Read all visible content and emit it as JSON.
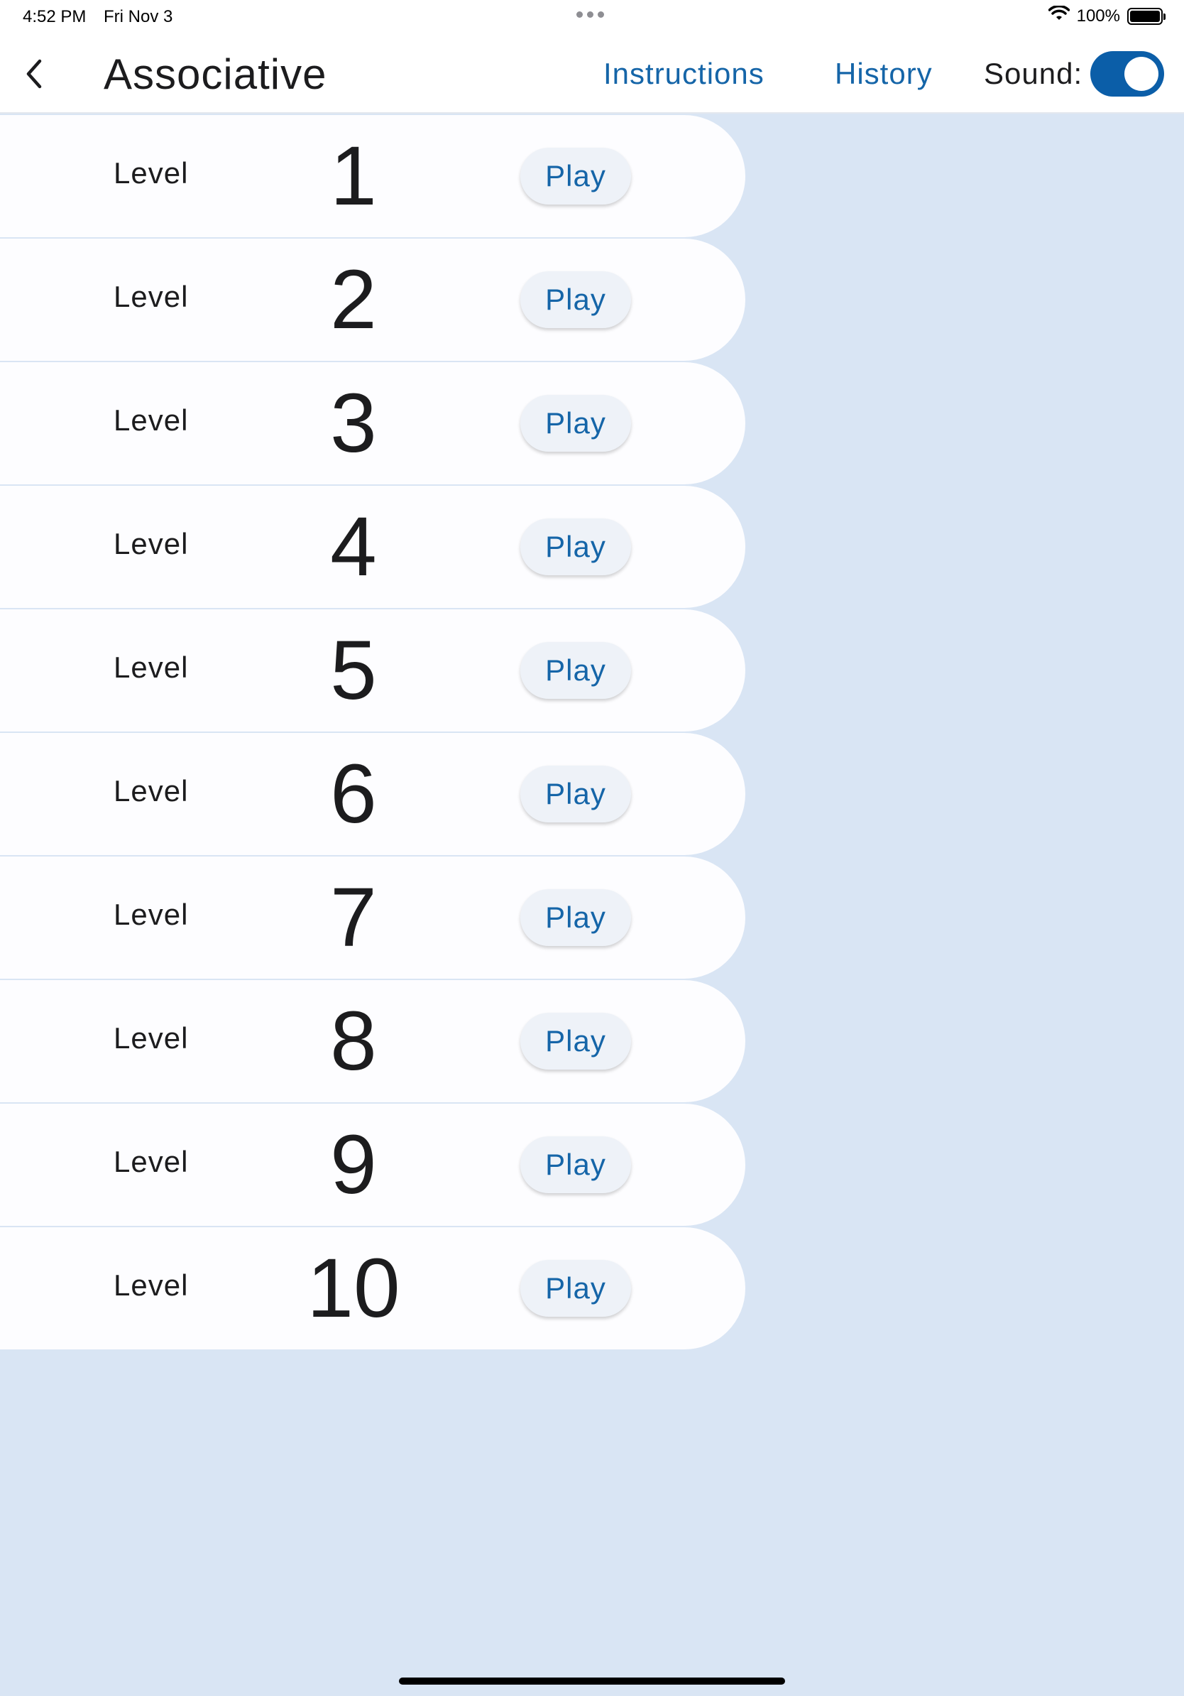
{
  "status_bar": {
    "time": "4:52 PM",
    "date": "Fri Nov 3",
    "battery": "100%"
  },
  "nav": {
    "title": "Associative",
    "instructions_label": "Instructions",
    "history_label": "History",
    "sound_label": "Sound:",
    "sound_on": true
  },
  "levels": [
    {
      "label": "Level",
      "number": "1",
      "play": "Play"
    },
    {
      "label": "Level",
      "number": "2",
      "play": "Play"
    },
    {
      "label": "Level",
      "number": "3",
      "play": "Play"
    },
    {
      "label": "Level",
      "number": "4",
      "play": "Play"
    },
    {
      "label": "Level",
      "number": "5",
      "play": "Play"
    },
    {
      "label": "Level",
      "number": "6",
      "play": "Play"
    },
    {
      "label": "Level",
      "number": "7",
      "play": "Play"
    },
    {
      "label": "Level",
      "number": "8",
      "play": "Play"
    },
    {
      "label": "Level",
      "number": "9",
      "play": "Play"
    },
    {
      "label": "Level",
      "number": "10",
      "play": "Play"
    }
  ],
  "colors": {
    "accent": "#1565a8",
    "toggle_on": "#0b5ea8",
    "background": "#d9e5f4"
  },
  "icons": {
    "back": "chevron-left-icon",
    "wifi": "wifi-icon",
    "battery": "battery-icon",
    "multitask": "more-dots-icon"
  }
}
